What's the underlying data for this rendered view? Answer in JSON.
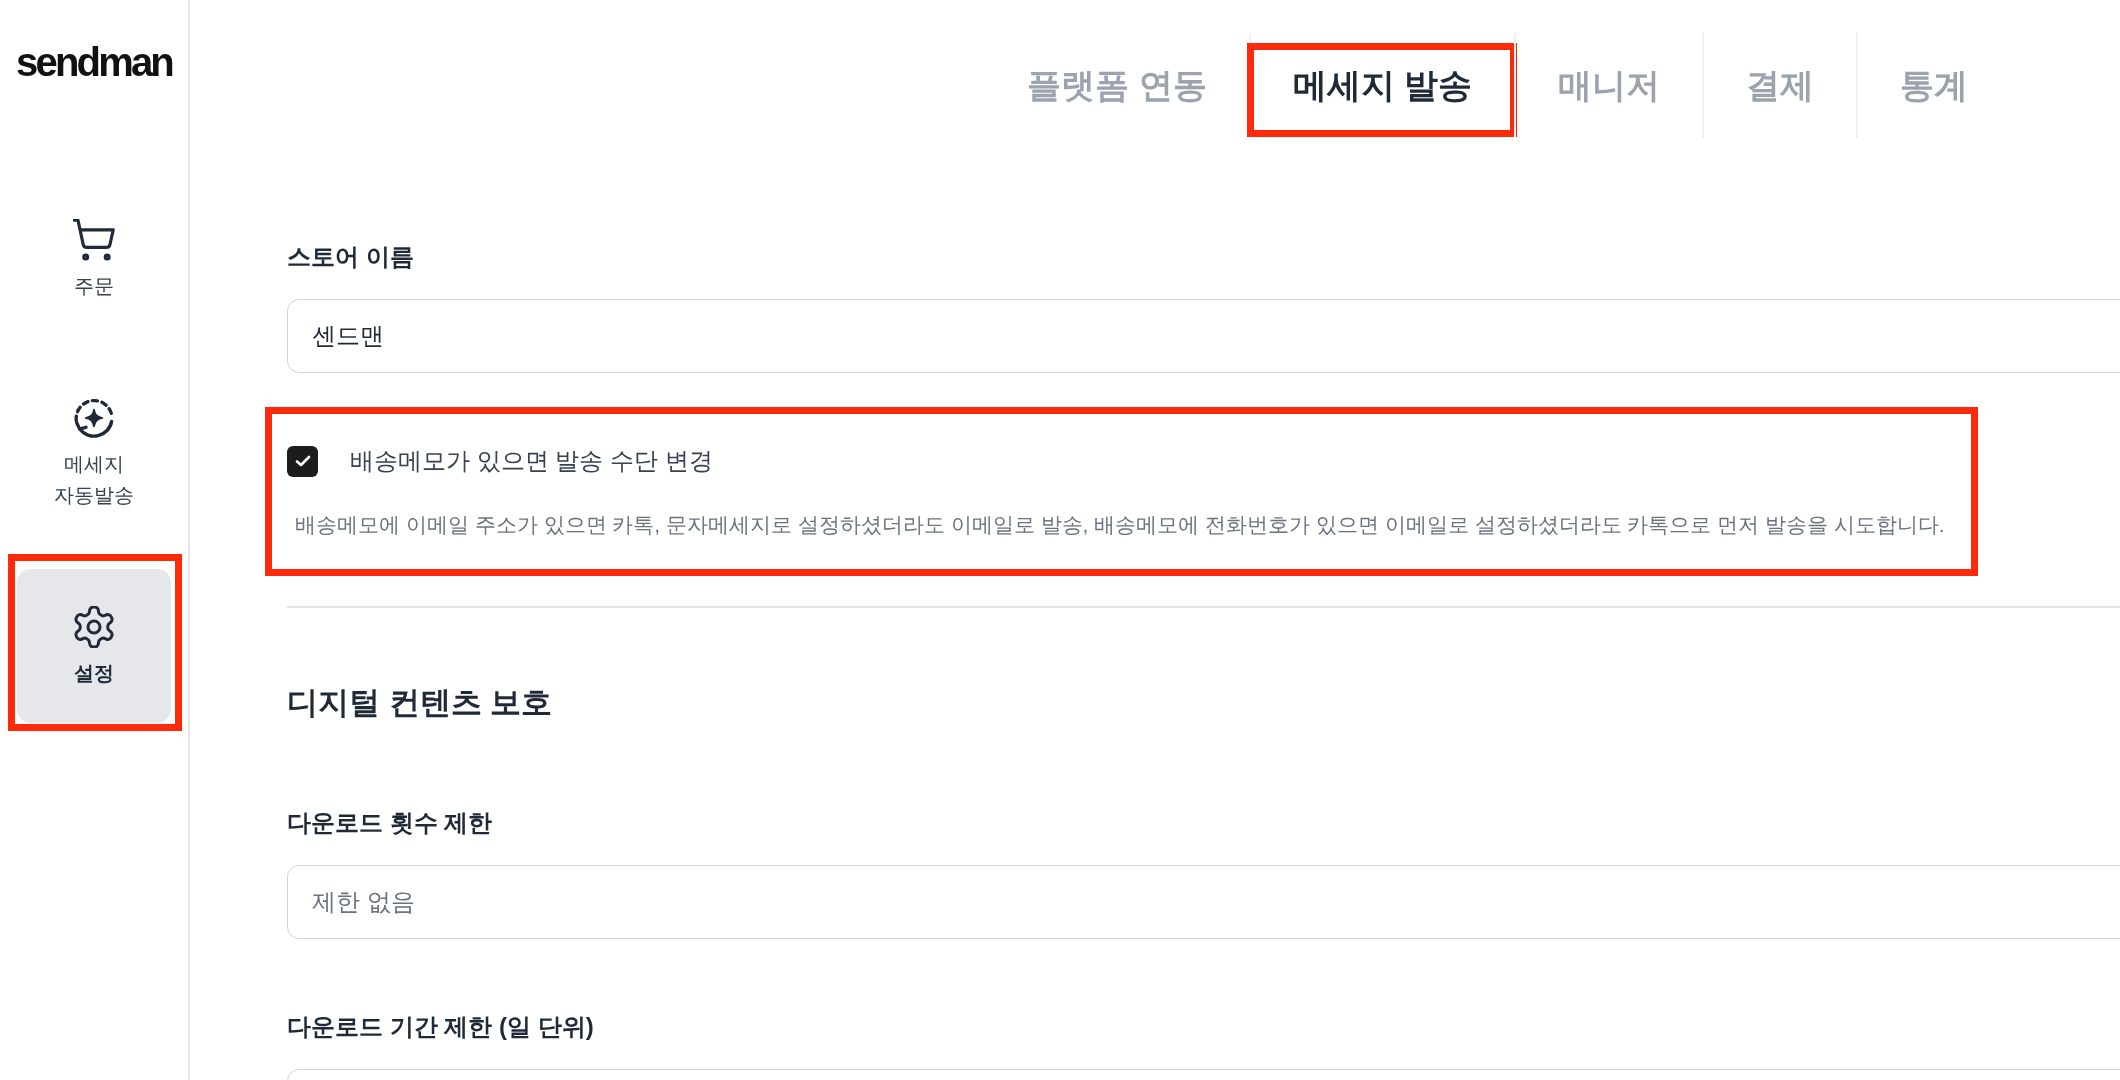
{
  "logo": {
    "text": "sendman"
  },
  "sidebar": {
    "items": [
      {
        "kind": "orders",
        "label": "주문",
        "selected": false,
        "highlighted": false
      },
      {
        "kind": "autosend",
        "label": "메세지 자동발송",
        "selected": false,
        "highlighted": false
      },
      {
        "kind": "settings",
        "label": "설정",
        "selected": true,
        "highlighted": true
      }
    ]
  },
  "tabs": [
    {
      "label": "플랫폼 연동",
      "selected": false,
      "highlighted": false
    },
    {
      "label": "메세지 발송",
      "selected": true,
      "highlighted": true
    },
    {
      "label": "매니저",
      "selected": false,
      "highlighted": false
    },
    {
      "label": "결제",
      "selected": false,
      "highlighted": false
    },
    {
      "label": "통계",
      "selected": false,
      "highlighted": false
    }
  ],
  "store_section": {
    "fields": [
      {
        "label": "스토어 이름",
        "value": "센드맨"
      }
    ],
    "options": [
      {
        "label": "배송메모가 있으면 발송 수단 변경",
        "checked": true,
        "description": "배송메모에 이메일 주소가 있으면 카톡, 문자메세지로 설정하셨더라도 이메일로 발송, 배송메모에 전화번호가 있으면 이메일로 설정하셨더라도 카톡으로 먼저 발송을 시도합니다.",
        "highlighted": true
      }
    ]
  },
  "digital_content_section": {
    "title": "디지털 컨텐츠 보호",
    "fields": [
      {
        "label": "다운로드 횟수 제한",
        "placeholder": "제한 없음"
      },
      {
        "label": "다운로드 기간 제한 (일 단위)"
      }
    ]
  }
}
